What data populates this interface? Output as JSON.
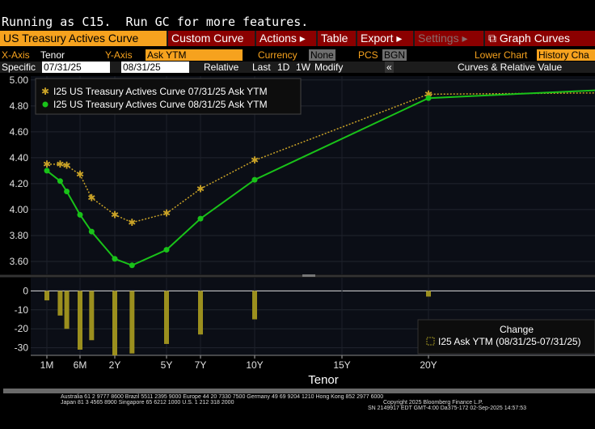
{
  "command_line": "Running as C15.  Run GC for more features.",
  "menu": {
    "curve_title": "US Treasury Actives Curve",
    "custom_curve": "Custom Curve",
    "actions": "Actions ▸",
    "table": "Table",
    "export": "Export ▸",
    "settings": "Settings ▸",
    "graph_curves": "Graph Curves"
  },
  "params": {
    "x_axis_label": "X-Axis",
    "x_axis_value": "Tenor",
    "y_axis_label": "Y-Axis",
    "y_axis_value": "Ask YTM",
    "currency_label": "Currency",
    "currency_value": "None",
    "pcs_label": "PCS",
    "pcs_value": "BGN",
    "lower_chart_label": "Lower Chart",
    "lower_chart_value": "History Cha",
    "specific_label": "Specific",
    "date1": "07/31/25",
    "date2": "08/31/25",
    "relative": "Relative",
    "last": "Last",
    "d1": "1D",
    "w1": "1W",
    "modify": "Modify",
    "collapse": "«",
    "curves_rel": "Curves & Relative Value"
  },
  "colors": {
    "series1": "#c9a227",
    "series2": "#19c219",
    "bars": "#9b8f1e",
    "accent": "#f6a21e",
    "menu_red": "#8b0000"
  },
  "chart_data": {
    "type": "line",
    "xlabel": "Tenor",
    "x_ticks": [
      "1M",
      "6M",
      "2Y",
      "5Y",
      "7Y",
      "10Y",
      "15Y",
      "20Y"
    ],
    "y_ticks": [
      "5.00",
      "4.80",
      "4.60",
      "4.40",
      "4.20",
      "4.00",
      "3.80",
      "3.60"
    ],
    "ylim": [
      3.5,
      5.03
    ],
    "series": [
      {
        "name": "I25 US Treasury Actives Curve 07/31/25 Ask YTM",
        "marker": "star",
        "x_years": [
          0.083,
          0.25,
          0.333,
          0.5,
          1,
          2,
          3,
          5,
          7,
          10,
          20,
          30
        ],
        "values": [
          4.35,
          4.35,
          4.34,
          4.27,
          4.09,
          3.96,
          3.9,
          3.97,
          4.16,
          4.38,
          4.89,
          4.9
        ]
      },
      {
        "name": "I25 US Treasury Actives Curve 08/31/25 Ask YTM",
        "marker": "dot",
        "x_years": [
          0.083,
          0.25,
          0.333,
          0.5,
          1,
          2,
          3,
          5,
          7,
          10,
          20,
          30
        ],
        "values": [
          4.3,
          4.22,
          4.14,
          3.96,
          3.83,
          3.62,
          3.57,
          3.69,
          3.93,
          4.23,
          4.86,
          4.92
        ]
      }
    ],
    "change": {
      "title": "Change",
      "legend": "I25 Ask YTM (08/31/25-07/31/25)",
      "y_ticks": [
        "0",
        "-10",
        "-20",
        "-30"
      ],
      "ylim": [
        -34,
        7
      ],
      "values": [
        -5,
        -13,
        -20,
        -31,
        -26,
        -34,
        -33,
        -28,
        -23,
        -15,
        -3
      ]
    }
  },
  "footer": {
    "line1": "Australia 61 2 9777 8600 Brazil 5511 2395 9000 Europe 44 20 7330 7500 Germany 49 69 9204 1210 Hong Kong 852 2977 6000",
    "line2a": "Japan 81 3 4565 8900       Singapore 65 6212 1000       U.S. 1 212 318 2000",
    "line2b": "Copyright 2025 Bloomberg Finance L.P.",
    "line3": "SN 2149917 EDT  GMT-4:00 Da375-172 02-Sep-2025 14:57:53"
  }
}
